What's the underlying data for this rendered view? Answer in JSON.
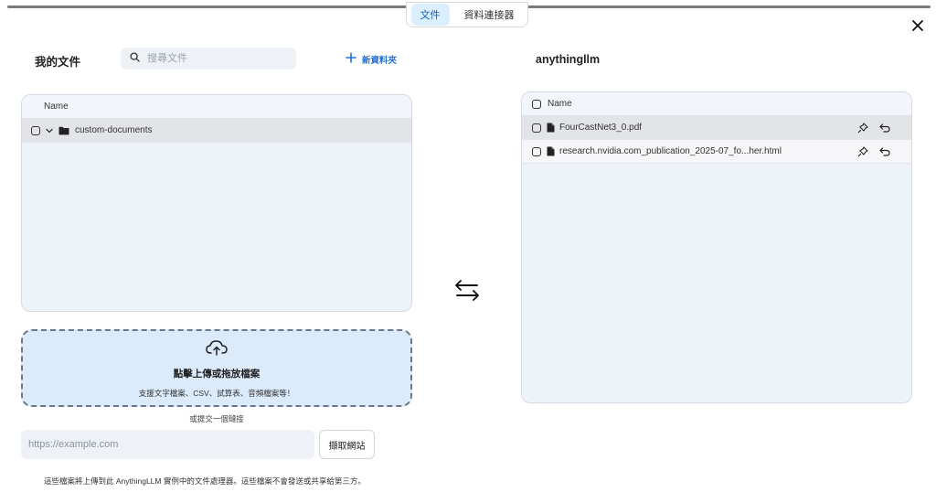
{
  "tabs": [
    {
      "label": "文件",
      "active": true
    },
    {
      "label": "資料連接器",
      "active": false
    }
  ],
  "left": {
    "title": "我的文件",
    "search_placeholder": "搜尋文件",
    "new_folder_label": "新資料夾",
    "column_name": "Name",
    "folders": [
      {
        "name": "custom-documents",
        "expanded": true
      }
    ]
  },
  "right": {
    "title": "anythingllm",
    "column_name": "Name",
    "files": [
      {
        "name": "FourCastNet3_0.pdf"
      },
      {
        "name": "research.nvidia.com_publication_2025-07_fo...her.html"
      }
    ]
  },
  "upload": {
    "title": "點擊上傳或拖放檔案",
    "subtitle": "支援文字檔案、CSV、試算表、音頻檔案等！",
    "or_link": "或提交一個鏈接",
    "url_placeholder": "https://example.com",
    "fetch_label": "擷取網站"
  },
  "footer": {
    "notice": "這些檔案將上傳到此 AnythingLLM 實例中的文件處理器。這些檔案不會發送或共享給第三方。"
  },
  "colors": {
    "accent": "#1f6fd6",
    "tab_active_bg": "#dbeefe",
    "panel_bg": "#eef2f9",
    "dropzone_bg": "#dcebfb"
  },
  "icons": {
    "close": "close-icon",
    "search": "search-icon",
    "plus": "plus-icon",
    "swap": "swap-arrows-icon",
    "upload": "cloud-upload-icon",
    "pin": "pin-icon",
    "return": "return-icon",
    "folder": "folder-icon",
    "file": "file-icon",
    "chevron": "chevron-down-icon"
  }
}
